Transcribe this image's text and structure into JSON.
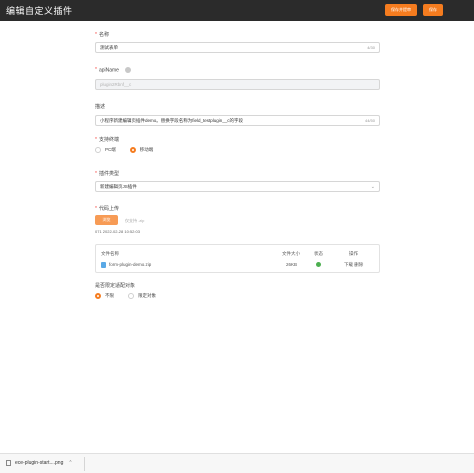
{
  "header": {
    "title": "编辑自定义插件",
    "save_draft_label": "保存并提审",
    "save_label": "保存"
  },
  "form": {
    "name": {
      "label": "名称",
      "value": "测试表单",
      "count": "4/30"
    },
    "apiname": {
      "label": "apiName",
      "value": "plugin2Rbnf__c"
    },
    "description": {
      "label": "描述",
      "value": "小程序新建编辑页插件demo。替换字段名称为field_testplugin__c的字段",
      "count": "44/50"
    },
    "terminal": {
      "label": "支持终端",
      "options": [
        "PC端",
        "移动端"
      ],
      "selected": "移动端"
    },
    "plugin_type": {
      "label": "插件类型",
      "value": "新建编辑页JS插件"
    },
    "code_upload": {
      "label": "代码上传",
      "button_label": "浏览",
      "hint": "仅支持 .zip",
      "uploaded_time": "071 2022-02-28 10:52:03"
    },
    "file_table": {
      "headers": [
        "文件名称",
        "文件大小",
        "状态",
        "操作"
      ],
      "rows": [
        {
          "name": "form-plugin-demo.zip",
          "size": "26KB",
          "status": "success",
          "actions": "下载 删除"
        }
      ]
    },
    "scope": {
      "label": "是否限定适配对象",
      "options": [
        "不限",
        "限定对象"
      ],
      "selected": "不限"
    }
  },
  "download_bar": {
    "filename": "ece-plugin-start....png"
  },
  "colors": {
    "accent": "#f57c1f",
    "topbar": "#2b2b2b",
    "success": "#4caf50"
  }
}
